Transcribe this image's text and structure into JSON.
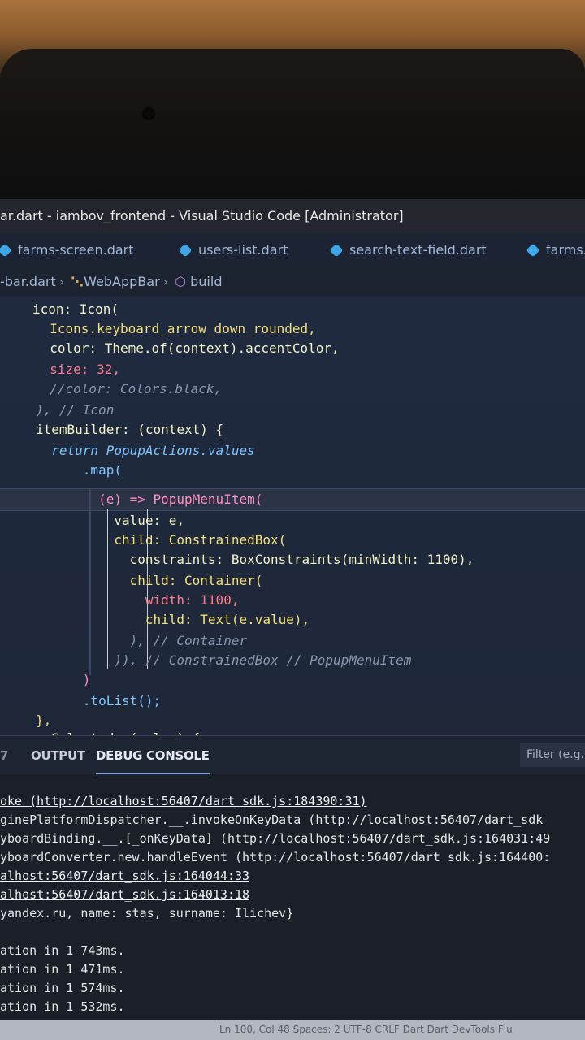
{
  "window": {
    "title": "ar.dart - iambov_frontend - Visual Studio Code [Administrator]"
  },
  "tabs": [
    {
      "label": "farms-screen.dart"
    },
    {
      "label": "users-list.dart"
    },
    {
      "label": "search-text-field.dart"
    },
    {
      "label": "farms."
    }
  ],
  "breadcrumb": {
    "file": "-bar.dart",
    "class": "WebAppBar",
    "method": "build"
  },
  "editor": {
    "lines": [
      "icon: Icon(",
      "  Icons.keyboard_arrow_down_rounded,",
      "  color: Theme.of(context).accentColor,",
      "  size: 32,",
      "  //color: Colors.black,",
      "), // Icon",
      "itemBuilder: (context) {",
      "  return PopupActions.values",
      "      .map(",
      "        (e) => PopupMenuItem(",
      "          value: e,",
      "          child: ConstrainedBox(",
      "            constraints: BoxConstraints(minWidth: 1100),",
      "            child: Container(",
      "              width: 1100,",
      "              child: Text(e.value),",
      "            ), // Container",
      "          )), // ConstrainedBox // PopupMenuItem",
      "      )",
      "      .toList();",
      "},",
      "onSelected: (value) {"
    ]
  },
  "panel": {
    "tabs": [
      {
        "label": "OUTPUT"
      },
      {
        "label": "DEBUG CONSOLE"
      }
    ],
    "filter_placeholder": "Filter (e.g. t",
    "side_mark": "7"
  },
  "console": {
    "lines": [
      "oke (http://localhost:56407/dart_sdk.js:184390:31)",
      "ginePlatformDispatcher.__.invokeOnKeyData (http://localhost:56407/dart_sdk",
      "yboardBinding.__.[_onKeyData] (http://localhost:56407/dart_sdk.js:164031:49",
      "yboardConverter.new.handleEvent (http://localhost:56407/dart_sdk.js:164400:",
      "alhost:56407/dart_sdk.js:164044:33",
      "alhost:56407/dart_sdk.js:164013:18",
      "yandex.ru, name: stas, surname: Ilichev}",
      "",
      "ation in 1 743ms.",
      "ation in 1 471ms.",
      "ation in 1 574ms.",
      "ation in 1 532ms."
    ]
  },
  "statusbar": {
    "text": "Ln 100, Col 48   Spaces: 2   UTF-8   CRLF   Dart   Dart DevTools   Flu"
  },
  "colors": {
    "accent": "#7aa6e8",
    "editor_bg": "#1f2a3f",
    "console_bg": "#1a1f28"
  }
}
